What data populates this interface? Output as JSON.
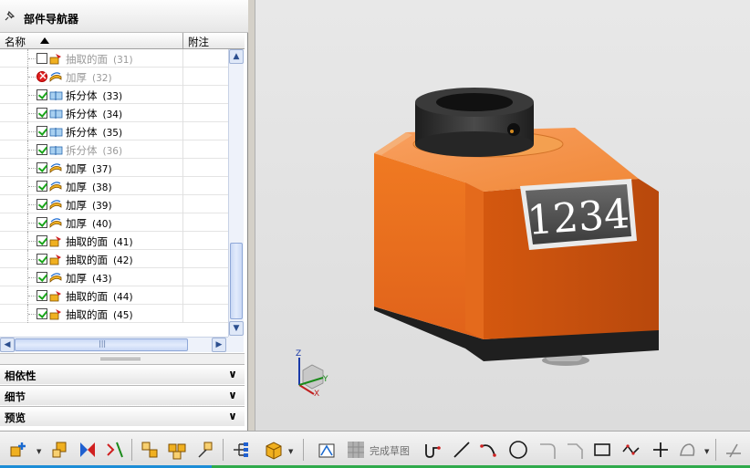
{
  "navigator": {
    "title": "部件导航器",
    "columns": {
      "name": "名称",
      "note": "附注"
    },
    "rows": [
      {
        "label": "抽取的面",
        "num": "(31)",
        "state": "unchecked",
        "icon": "extract-face-icon",
        "dim": true
      },
      {
        "label": "加厚",
        "num": "(32)",
        "state": "error",
        "icon": "thicken-icon",
        "dim": true
      },
      {
        "label": "拆分体",
        "num": "(33)",
        "state": "checked",
        "icon": "split-body-icon",
        "dim": false
      },
      {
        "label": "拆分体",
        "num": "(34)",
        "state": "checked",
        "icon": "split-body-icon",
        "dim": false
      },
      {
        "label": "拆分体",
        "num": "(35)",
        "state": "checked",
        "icon": "split-body-icon",
        "dim": false
      },
      {
        "label": "拆分体",
        "num": "(36)",
        "state": "checked",
        "icon": "split-body-icon",
        "dim": true
      },
      {
        "label": "加厚",
        "num": "(37)",
        "state": "checked",
        "icon": "thicken-icon",
        "dim": false
      },
      {
        "label": "加厚",
        "num": "(38)",
        "state": "checked",
        "icon": "thicken-icon",
        "dim": false
      },
      {
        "label": "加厚",
        "num": "(39)",
        "state": "checked",
        "icon": "thicken-icon",
        "dim": false
      },
      {
        "label": "加厚",
        "num": "(40)",
        "state": "checked",
        "icon": "thicken-icon",
        "dim": false
      },
      {
        "label": "抽取的面",
        "num": "(41)",
        "state": "checked",
        "icon": "extract-face-icon",
        "dim": false
      },
      {
        "label": "抽取的面",
        "num": "(42)",
        "state": "checked",
        "icon": "extract-face-icon",
        "dim": false
      },
      {
        "label": "加厚",
        "num": "(43)",
        "state": "checked",
        "icon": "thicken-icon",
        "dim": false
      },
      {
        "label": "抽取的面",
        "num": "(44)",
        "state": "checked",
        "icon": "extract-face-icon",
        "dim": false
      },
      {
        "label": "抽取的面",
        "num": "(45)",
        "state": "checked",
        "icon": "extract-face-icon",
        "dim": false
      }
    ],
    "hscroll_grip": "|||",
    "sections": [
      {
        "label": "相依性"
      },
      {
        "label": "细节"
      },
      {
        "label": "预览"
      }
    ]
  },
  "viewport": {
    "counter_display": "1234",
    "triad": {
      "x": "X",
      "y": "Y",
      "z": "Z"
    },
    "colors": {
      "body": "#f07020",
      "cap": "#2a2a2a",
      "background": "#e2e2e2"
    }
  },
  "toolbar": {
    "finish_sketch_label": "完成草图"
  }
}
